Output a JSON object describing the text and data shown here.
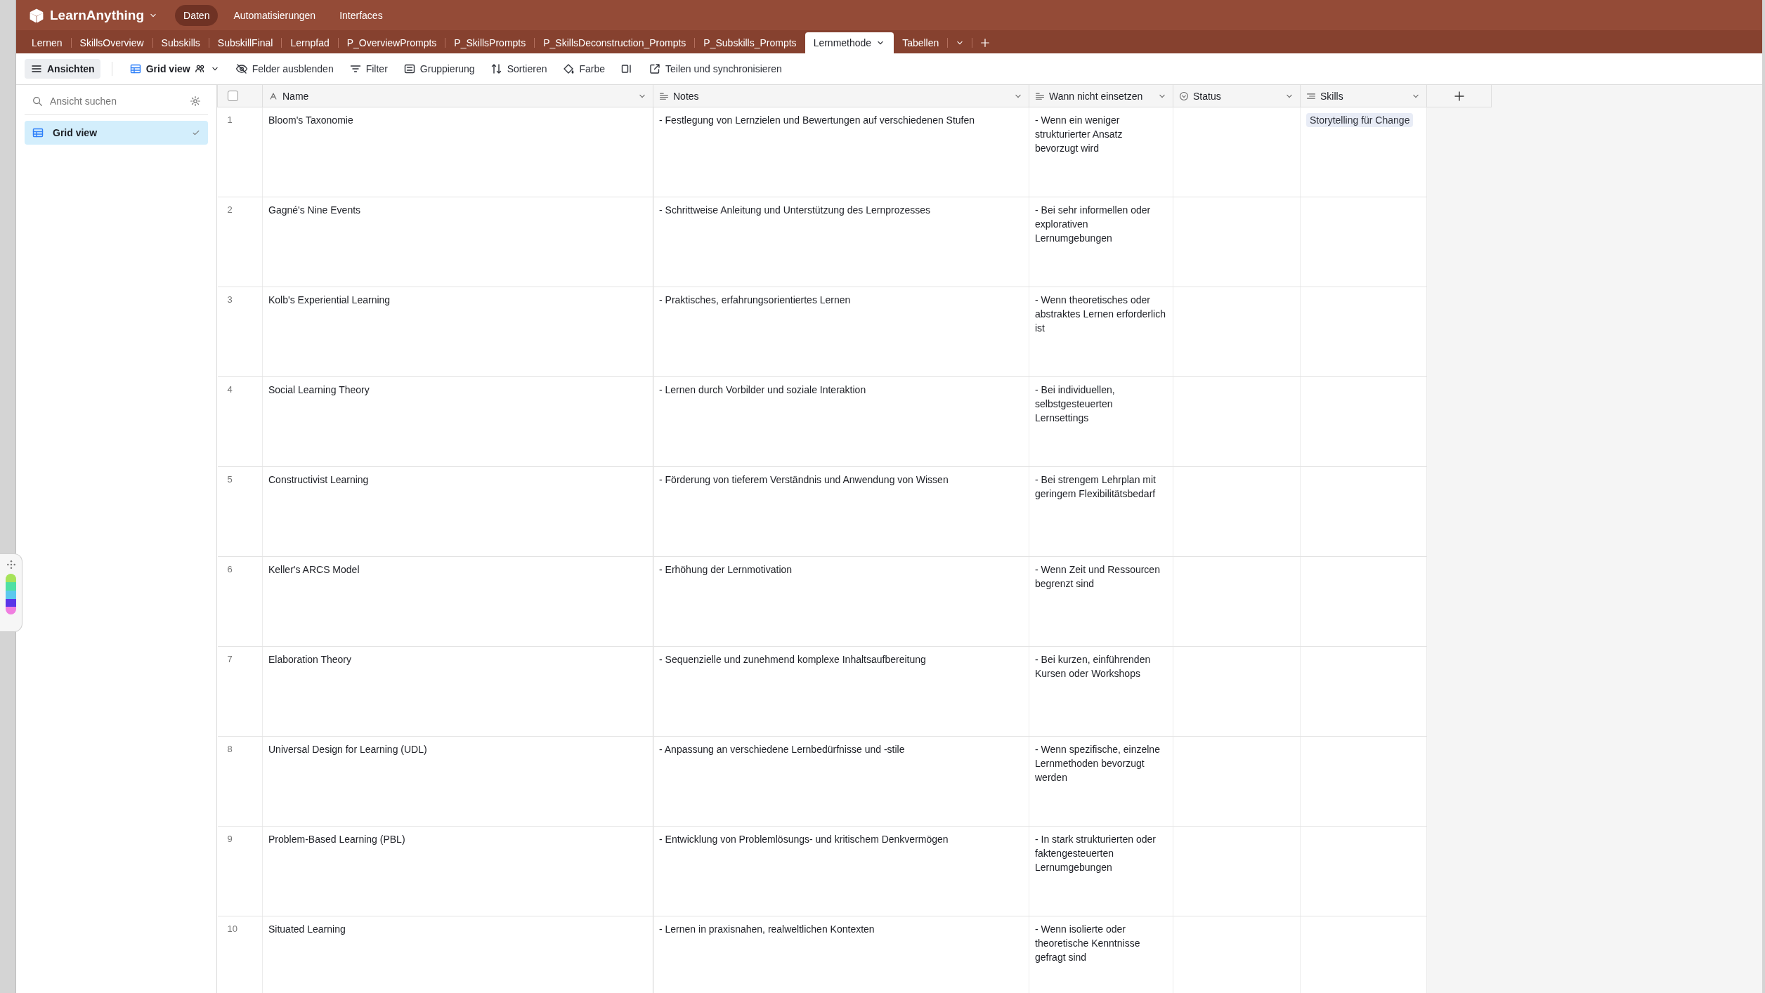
{
  "app": {
    "name": "LearnAnything"
  },
  "nav": [
    {
      "label": "Daten",
      "selected": true
    },
    {
      "label": "Automatisierungen",
      "selected": false
    },
    {
      "label": "Interfaces",
      "selected": false
    }
  ],
  "tabs": [
    {
      "label": "Lernen",
      "selected": false
    },
    {
      "label": "SkillsOverview",
      "selected": false
    },
    {
      "label": "Subskills",
      "selected": false
    },
    {
      "label": "SubskillFinal",
      "selected": false
    },
    {
      "label": "Lernpfad",
      "selected": false
    },
    {
      "label": "P_OverviewPrompts",
      "selected": false
    },
    {
      "label": "P_SkillsPrompts",
      "selected": false
    },
    {
      "label": "P_SkillsDeconstruction_Prompts",
      "selected": false
    },
    {
      "label": "P_Subskills_Prompts",
      "selected": false
    },
    {
      "label": "Lernmethode",
      "selected": true
    },
    {
      "label": "Tabellen",
      "selected": false
    }
  ],
  "toolbar": [
    {
      "kind": "views",
      "label": "Ansichten"
    },
    {
      "kind": "grid",
      "label": "Grid view"
    },
    {
      "kind": "hide",
      "label": "Felder ausblenden"
    },
    {
      "kind": "filter",
      "label": "Filter"
    },
    {
      "kind": "group",
      "label": "Gruppierung"
    },
    {
      "kind": "sort",
      "label": "Sortieren"
    },
    {
      "kind": "color",
      "label": "Farbe"
    },
    {
      "kind": "row-height"
    },
    {
      "kind": "share",
      "label": "Teilen und synchronisieren"
    }
  ],
  "sidebar": {
    "search": {
      "placeholder": "Ansicht suchen"
    },
    "views": [
      {
        "label": "Grid view",
        "selected": true
      }
    ]
  },
  "table": {
    "select_all": {
      "checked": false
    },
    "columns": [
      {
        "kind": "primary",
        "label": "Name"
      },
      {
        "kind": "longtext",
        "label": "Notes"
      },
      {
        "kind": "longtext",
        "label": "Wann nicht einsetzen"
      },
      {
        "kind": "status",
        "label": "Status"
      },
      {
        "kind": "link",
        "label": "Skills"
      }
    ],
    "rows": [
      {
        "number": "1",
        "name": "Bloom's Taxonomie",
        "notes": "- Festlegung von Lernzielen und Bewertungen auf verschiedenen Stufen",
        "wann": "- Wenn ein weniger strukturierter Ansatz bevorzugt wird",
        "skills": [
          "Storytelling für Change"
        ]
      },
      {
        "number": "2",
        "name": "Gagné's Nine Events",
        "notes": "- Schrittweise Anleitung und Unterstützung des Lernprozesses",
        "wann": "- Bei sehr informellen oder explorativen Lernumgebungen"
      },
      {
        "number": "3",
        "name": "Kolb's Experiential Learning",
        "notes": "- Praktisches, erfahrungsorientiertes Lernen",
        "wann": "- Wenn theoretisches oder abstraktes Lernen erforderlich ist"
      },
      {
        "number": "4",
        "name": "Social Learning Theory",
        "notes": "- Lernen durch Vorbilder und soziale Interaktion",
        "wann": "- Bei individuellen, selbstgesteuerten Lernsettings"
      },
      {
        "number": "5",
        "name": "Constructivist Learning",
        "notes": "- Förderung von tieferem Verständnis und Anwendung von Wissen",
        "wann": "- Bei strengem Lehrplan mit geringem Flexibilitätsbedarf"
      },
      {
        "number": "6",
        "name": "Keller's ARCS Model",
        "notes": "- Erhöhung der Lernmotivation",
        "wann": "- Wenn Zeit und Ressourcen begrenzt sind"
      },
      {
        "number": "7",
        "name": "Elaboration Theory",
        "notes": "- Sequenzielle und zunehmend komplexe Inhaltsaufbereitung",
        "wann": "- Bei kurzen, einführenden Kursen oder Workshops"
      },
      {
        "number": "8",
        "name": "Universal Design for Learning (UDL)",
        "notes": "- Anpassung an verschiedene Lernbedürfnisse und -stile",
        "wann": "- Wenn spezifische, einzelne Lernmethoden bevorzugt werden"
      },
      {
        "number": "9",
        "name": "Problem-Based Learning (PBL)",
        "notes": "- Entwicklung von Problemlösungs- und kritischem Denkvermögen",
        "wann": "- In stark strukturierten oder faktengesteuerten Lernumgebungen"
      },
      {
        "number": "10",
        "name": "Situated Learning",
        "notes": "- Lernen in praxisnahen, realweltlichen Kontexten",
        "wann": "- Wenn isolierte oder theoretische Kenntnisse gefragt sind"
      }
    ]
  }
}
